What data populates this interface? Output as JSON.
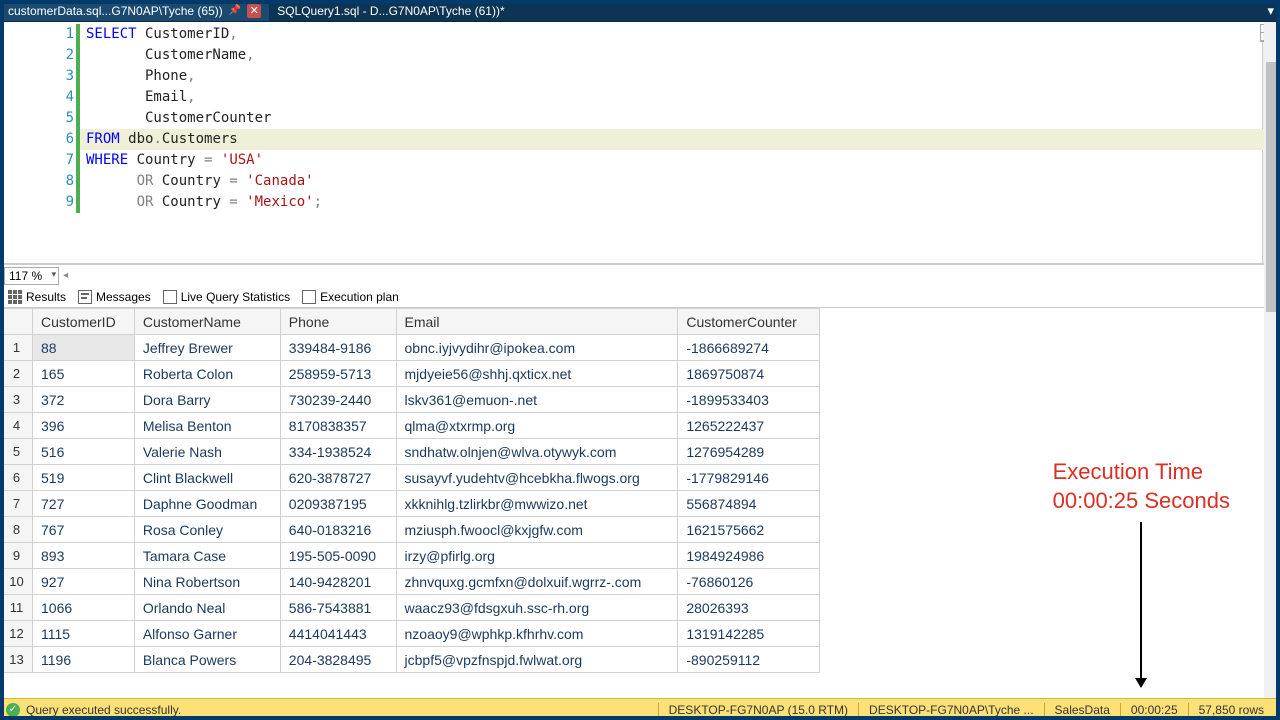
{
  "tabs": [
    {
      "label": "customerData.sql...G7N0AP\\Tyche (65))",
      "pinned": true,
      "active": true
    },
    {
      "label": "SQLQuery1.sql - D...G7N0AP\\Tyche (61))*",
      "pinned": false,
      "active": false
    }
  ],
  "code": {
    "lines": [
      {
        "n": 1,
        "tokens": [
          [
            "kw",
            "SELECT"
          ],
          [
            "ident",
            " CustomerID"
          ],
          [
            "op",
            ","
          ]
        ]
      },
      {
        "n": 2,
        "tokens": [
          [
            "ident",
            "       CustomerName"
          ],
          [
            "op",
            ","
          ]
        ]
      },
      {
        "n": 3,
        "tokens": [
          [
            "ident",
            "       Phone"
          ],
          [
            "op",
            ","
          ]
        ]
      },
      {
        "n": 4,
        "tokens": [
          [
            "ident",
            "       Email"
          ],
          [
            "op",
            ","
          ]
        ]
      },
      {
        "n": 5,
        "tokens": [
          [
            "ident",
            "       CustomerCounter"
          ]
        ]
      },
      {
        "n": 6,
        "hl": true,
        "tokens": [
          [
            "kw",
            "FROM"
          ],
          [
            "ident",
            " dbo"
          ],
          [
            "op",
            "."
          ],
          [
            "ident",
            "Customers"
          ]
        ]
      },
      {
        "n": 7,
        "tokens": [
          [
            "kw",
            "WHERE"
          ],
          [
            "ident",
            " Country "
          ],
          [
            "op",
            "="
          ],
          [
            "ident",
            " "
          ],
          [
            "str",
            "'USA'"
          ]
        ]
      },
      {
        "n": 8,
        "tokens": [
          [
            "ident",
            "      "
          ],
          [
            "op",
            "OR"
          ],
          [
            "ident",
            " Country "
          ],
          [
            "op",
            "="
          ],
          [
            "ident",
            " "
          ],
          [
            "str",
            "'Canada'"
          ]
        ]
      },
      {
        "n": 9,
        "tokens": [
          [
            "ident",
            "      "
          ],
          [
            "op",
            "OR"
          ],
          [
            "ident",
            " Country "
          ],
          [
            "op",
            "="
          ],
          [
            "ident",
            " "
          ],
          [
            "str",
            "'Mexico'"
          ],
          [
            "op",
            ";"
          ]
        ]
      }
    ]
  },
  "zoom": "117 %",
  "result_tabs": {
    "results": "Results",
    "messages": "Messages",
    "live": "Live Query Statistics",
    "plan": "Execution plan"
  },
  "grid": {
    "columns": [
      "CustomerID",
      "CustomerName",
      "Phone",
      "Email",
      "CustomerCounter"
    ],
    "rows": [
      {
        "n": 1,
        "cells": [
          "88",
          "Jeffrey Brewer",
          "339484-9186",
          "obnc.iyjvydihr@ipokea.com",
          "-1866689274"
        ]
      },
      {
        "n": 2,
        "cells": [
          "165",
          "Roberta Colon",
          "258959-5713",
          "mjdyeie56@shhj.qxticx.net",
          "1869750874"
        ]
      },
      {
        "n": 3,
        "cells": [
          "372",
          "Dora Barry",
          "730239-2440",
          "lskv361@emuon-.net",
          "-1899533403"
        ]
      },
      {
        "n": 4,
        "cells": [
          "396",
          "Melisa Benton",
          "8170838357",
          "qlma@xtxrmp.org",
          "1265222437"
        ]
      },
      {
        "n": 5,
        "cells": [
          "516",
          "Valerie Nash",
          "334-1938524",
          "sndhatw.olnjen@wlva.otywyk.com",
          "1276954289"
        ]
      },
      {
        "n": 6,
        "cells": [
          "519",
          "Clint Blackwell",
          "620-3878727",
          "susayvf.yudehtv@hcebkha.flwogs.org",
          "-1779829146"
        ]
      },
      {
        "n": 7,
        "cells": [
          "727",
          "Daphne Goodman",
          "0209387195",
          "xkknihlg.tzlirkbr@mwwizo.net",
          "556874894"
        ]
      },
      {
        "n": 8,
        "cells": [
          "767",
          "Rosa Conley",
          "640-0183216",
          "mziusph.fwoocl@kxjgfw.com",
          "1621575662"
        ]
      },
      {
        "n": 9,
        "cells": [
          "893",
          "Tamara Case",
          "195-505-0090",
          "irzy@pfirlg.org",
          "1984924986"
        ]
      },
      {
        "n": 10,
        "cells": [
          "927",
          "Nina Robertson",
          "140-9428201",
          "zhnvquxg.gcmfxn@dolxuif.wgrrz-.com",
          "-76860126"
        ]
      },
      {
        "n": 11,
        "cells": [
          "1066",
          "Orlando Neal",
          "586-7543881",
          "waacz93@fdsgxuh.ssc-rh.org",
          "28026393"
        ]
      },
      {
        "n": 12,
        "cells": [
          "1115",
          "Alfonso Garner",
          "4414041443",
          "nzoaoy9@wphkp.kfhrhv.com",
          "1319142285"
        ]
      },
      {
        "n": 13,
        "cells": [
          "1196",
          "Blanca Powers",
          "204-3828495",
          "jcbpf5@vpzfnspjd.fwlwat.org",
          "-890259112"
        ]
      }
    ]
  },
  "annotation": {
    "line1": "Execution Time",
    "line2": "00:00:25 Seconds"
  },
  "status": {
    "message": "Query executed successfully.",
    "server": "DESKTOP-FG7N0AP (15.0 RTM)",
    "conn": "DESKTOP-FG7N0AP\\Tyche ...",
    "db": "SalesData",
    "time": "00:00:25",
    "rows": "57,850 rows"
  }
}
